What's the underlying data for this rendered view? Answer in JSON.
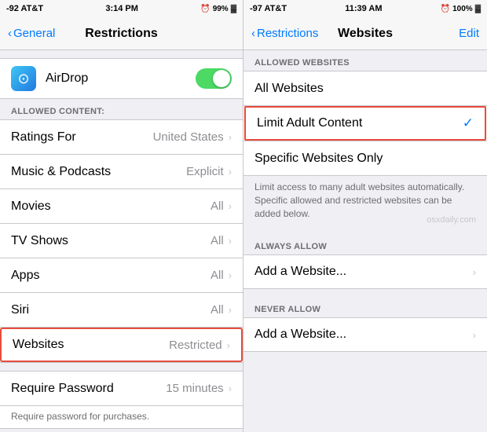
{
  "left": {
    "statusBar": {
      "carrier": "-92 AT&T",
      "signal": "▋▋▋",
      "wifi": "wifi",
      "time": "3:14 PM",
      "alarm": "⏰",
      "battery": "99%"
    },
    "navBar": {
      "backLabel": "General",
      "title": "Restrictions"
    },
    "airdrop": {
      "label": "AirDrop",
      "toggleOn": true
    },
    "sectionHeader": "ALLOWED CONTENT:",
    "items": [
      {
        "label": "Ratings For",
        "value": "United States",
        "hasChevron": true
      },
      {
        "label": "Music & Podcasts",
        "value": "Explicit",
        "hasChevron": true
      },
      {
        "label": "Movies",
        "value": "All",
        "hasChevron": true
      },
      {
        "label": "TV Shows",
        "value": "All",
        "hasChevron": true
      },
      {
        "label": "Apps",
        "value": "All",
        "hasChevron": true
      },
      {
        "label": "Siri",
        "value": "All",
        "hasChevron": true
      },
      {
        "label": "Websites",
        "value": "Restricted",
        "hasChevron": true,
        "highlighted": true
      }
    ],
    "requirePassword": {
      "label": "Require Password",
      "value": "15 minutes",
      "description": "Require password for purchases."
    }
  },
  "right": {
    "statusBar": {
      "carrier": "-97 AT&T",
      "time": "11:39 AM",
      "battery": "100%"
    },
    "navBar": {
      "backLabel": "Restrictions",
      "title": "Websites",
      "editLabel": "Edit"
    },
    "sectionHeader": "ALLOWED WEBSITES",
    "options": [
      {
        "label": "All Websites",
        "selected": false
      },
      {
        "label": "Limit Adult Content",
        "selected": true,
        "highlighted": true
      },
      {
        "label": "Specific Websites Only",
        "selected": false
      }
    ],
    "description": "Limit access to many adult websites automatically. Specific allowed and restricted websites can be added below.",
    "alwaysAllow": {
      "header": "ALWAYS ALLOW",
      "addLabel": "Add a Website..."
    },
    "neverAllow": {
      "header": "NEVER ALLOW",
      "addLabel": "Add a Website..."
    },
    "watermark": "osxdaily.com"
  }
}
